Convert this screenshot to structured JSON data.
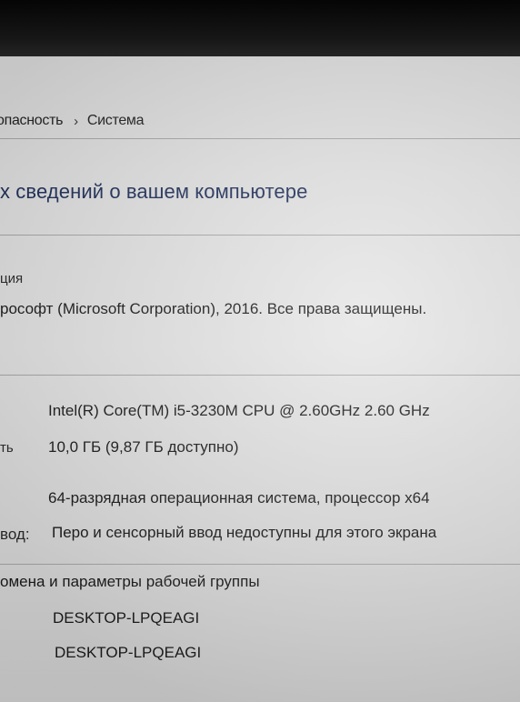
{
  "window": {
    "breadcrumb": {
      "parent_label": "опасность",
      "separator": "›",
      "current_label": "Система"
    },
    "page_title": "х сведений о вашем компьютере"
  },
  "windows_edition": {
    "section_label": "ция",
    "copyright": "рософт (Microsoft Corporation), 2016. Все права защищены."
  },
  "system": {
    "processor_value": "Intel(R) Core(TM) i5-3230M CPU @ 2.60GHz   2.60 GHz",
    "ram_label": "ть",
    "ram_value": "10,0 ГБ (9,87 ГБ доступно)",
    "system_type_value": "64-разрядная операционная система, процессор x64",
    "pen_touch_label": "вод:",
    "pen_touch_value": "Перо и сенсорный ввод недоступны для этого экрана"
  },
  "computer_name": {
    "section_label": "омена и параметры рабочей группы",
    "computer_name_value": "DESKTOP-LPQEAGI",
    "full_name_value": "DESKTOP-LPQEAGI"
  }
}
